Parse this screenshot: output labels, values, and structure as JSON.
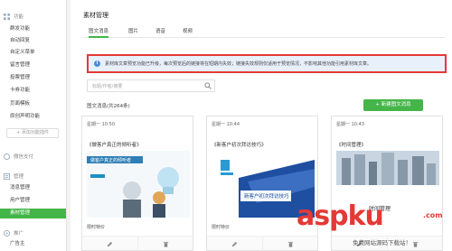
{
  "sidebar": {
    "section_function": "功能",
    "function_items": [
      "群发功能",
      "自动回复",
      "自定义菜单",
      "留言管理",
      "投票管理",
      "卡券功能",
      "页面模板",
      "原创声明功能"
    ],
    "add_plugin": "+ 添加功能插件",
    "section_pay": "微信支付",
    "section_manage": "管理",
    "manage_items": [
      "消息管理",
      "用户管理",
      "素材管理"
    ],
    "active_item": "素材管理",
    "section_promo": "推广",
    "promo_items": [
      "广告主"
    ]
  },
  "main": {
    "title": "素材管理",
    "tabs": [
      "图文消息",
      "图片",
      "语音",
      "视频"
    ],
    "active_tab": "图文消息",
    "notice": "素材库文章预览功能已升级，每次预览后的链接将在短期内失效；链接失效规则仅适用于预览情况，不影响其他功能引用素材库文章。",
    "search_placeholder": "标题/作者/摘要",
    "count_label": "图文消息(共264条)",
    "new_button": "+ 新建图文消息"
  },
  "cards": [
    {
      "date": "星期一 10:50",
      "title": "《做客户真正的倾听者》",
      "sub": "限时特价",
      "banner": "做客户真正的倾听者"
    },
    {
      "date": "星期一 10:44",
      "title": "《新客户初次拜访技巧》",
      "sub": "限时特价",
      "banner": "新客户初次拜访技巧"
    },
    {
      "date": "星期一 10:43",
      "title": "《时间管理》",
      "sub": "",
      "banner": "时间管理"
    }
  ],
  "watermark": {
    "main": "aspku",
    "com": ".com",
    "sub": "免费网站源码下载站！"
  },
  "colors": {
    "accent": "#44b549",
    "notice_border": "#e53935",
    "notice_bg": "#e8f0fb"
  }
}
